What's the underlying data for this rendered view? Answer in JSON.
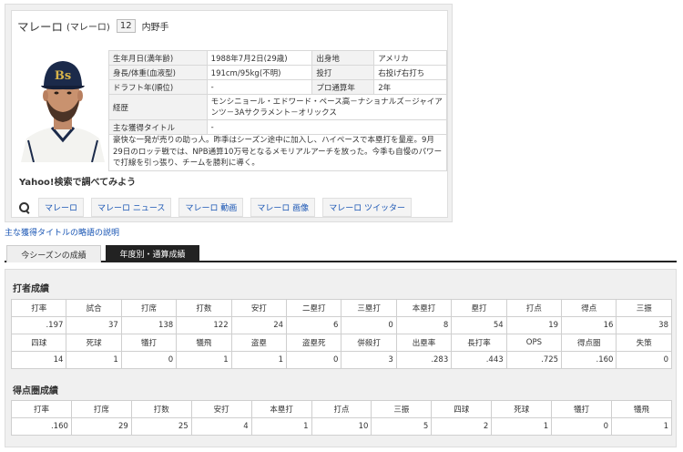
{
  "player": {
    "name": "マレーロ",
    "kana": "(マレーロ)",
    "number": "12",
    "position": "内野手"
  },
  "info": {
    "birth_label": "生年月日(満年齢)",
    "birth_value": "1988年7月2日(29歳)",
    "origin_label": "出身地",
    "origin_value": "アメリカ",
    "body_label": "身長/体重(血液型)",
    "body_value": "191cm/95kg(不明)",
    "bats_label": "投打",
    "bats_value": "右投げ右打ち",
    "draft_label": "ドラフト年(順位)",
    "draft_value": "-",
    "pro_years_label": "プロ通算年",
    "pro_years_value": "2年",
    "career_label": "経歴",
    "career_value": "モンシニョール・エドワード・ペース高－ナショナルズ－ジャイアンツ－3Aサクラメント－オリックス",
    "titles_label": "主な獲得タイトル",
    "titles_value": "-",
    "description": "豪快な一発が売りの助っ人。昨季はシーズン途中に加入し、ハイペースで本塁打を量産。9月29日のロッテ戦では、NPB通算10万号となるメモリアルアーチを放った。今季も自慢のパワーで打線を引っ張り、チームを勝利に導く。"
  },
  "search": {
    "title": "Yahoo!検索で調べてみよう",
    "links": [
      "マレーロ",
      "マレーロ ニュース",
      "マレーロ 動画",
      "マレーロ 画像",
      "マレーロ ツイッター"
    ]
  },
  "title_note_link": "主な獲得タイトルの略語の説明",
  "tabs": {
    "current": "今シーズンの成績",
    "yearly": "年度別・通算成績"
  },
  "batting": {
    "title": "打者成績",
    "headers1": [
      "打率",
      "試合",
      "打席",
      "打数",
      "安打",
      "二塁打",
      "三塁打",
      "本塁打",
      "塁打",
      "打点",
      "得点",
      "三振"
    ],
    "values1": [
      ".197",
      "37",
      "138",
      "122",
      "24",
      "6",
      "0",
      "8",
      "54",
      "19",
      "16",
      "38"
    ],
    "headers2": [
      "四球",
      "死球",
      "犠打",
      "犠飛",
      "盗塁",
      "盗塁死",
      "併殺打",
      "出塁率",
      "長打率",
      "OPS",
      "得点圏",
      "失策"
    ],
    "values2": [
      "14",
      "1",
      "0",
      "1",
      "1",
      "0",
      "3",
      ".283",
      ".443",
      ".725",
      ".160",
      "0"
    ]
  },
  "scoring": {
    "title": "得点圏成績",
    "headers": [
      "打率",
      "打席",
      "打数",
      "安打",
      "本塁打",
      "打点",
      "三振",
      "四球",
      "死球",
      "犠打",
      "犠飛"
    ],
    "values": [
      ".160",
      "29",
      "25",
      "4",
      "1",
      "10",
      "5",
      "2",
      "1",
      "0",
      "1"
    ]
  }
}
